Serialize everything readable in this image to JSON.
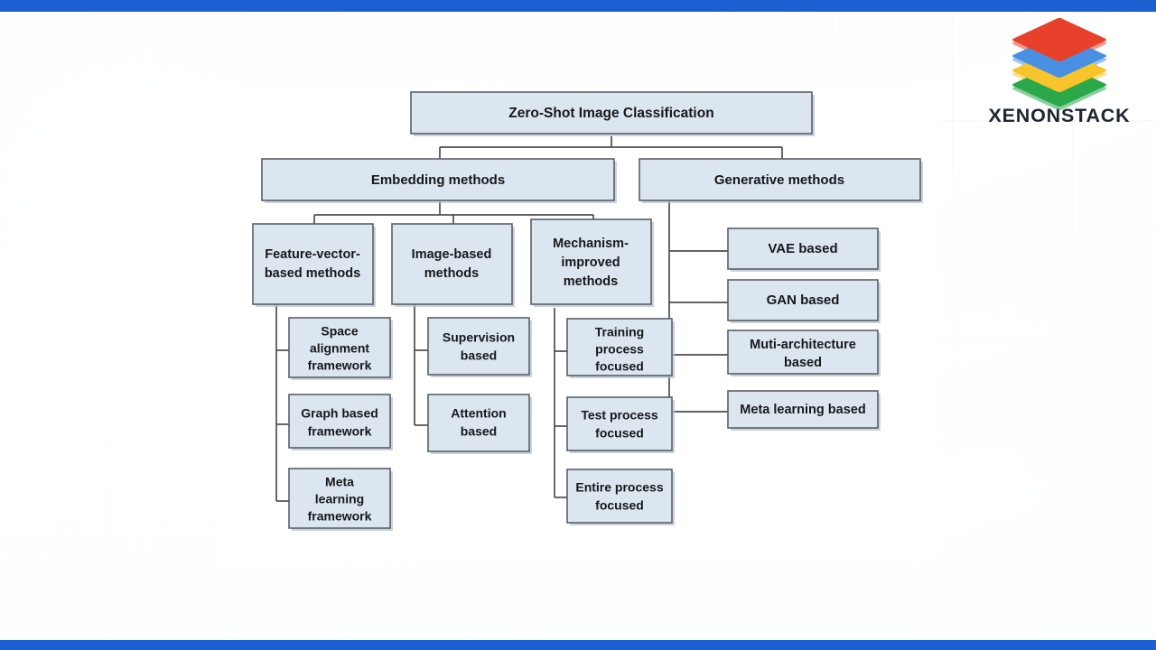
{
  "brand": {
    "name": "XENONSTACK",
    "logo_icon": "stacked-layers-logo",
    "accent_color": "#1b5fd1",
    "wordmark_color": "#1e2533",
    "layer_colors": [
      "#e8412b",
      "#4a90e2",
      "#f7c52b",
      "#2aa84a"
    ]
  },
  "diagram": {
    "type": "hierarchy-tree",
    "node_fill": "#dce6f1",
    "node_stroke": "#5a5f66",
    "link_color": "#4d4d4d",
    "nodes": {
      "root": "Zero-Shot Image Classification",
      "embedding": "Embedding methods",
      "generative": "Generative methods",
      "feature_vector": "Feature-vector-based methods",
      "image_based": "Image-based methods",
      "mechanism": "Mechanism-improved methods",
      "space_alignment": "Space alignment framework",
      "graph_based": "Graph based framework",
      "meta_learning_fw": "Meta learning framework",
      "supervision": "Supervision based",
      "attention": "Attention based",
      "training_process": "Training process focused",
      "test_process": "Test process focused",
      "entire_process": "Entire process focused",
      "vae": "VAE based",
      "gan": "GAN based",
      "multi_arch": "Muti-architecture based",
      "meta_learning_based": "Meta learning based"
    },
    "node_lines": {
      "root": [
        "Zero-Shot Image Classification"
      ],
      "embedding": [
        "Embedding methods"
      ],
      "generative": [
        "Generative methods"
      ],
      "feature_vector": [
        "Feature-vector-",
        "based methods"
      ],
      "image_based": [
        "Image-based",
        "methods"
      ],
      "mechanism": [
        "Mechanism-",
        "improved",
        "methods"
      ],
      "space_alignment": [
        "Space",
        "alignment",
        "framework"
      ],
      "graph_based": [
        "Graph based",
        "framework"
      ],
      "meta_learning_fw": [
        "Meta",
        "learning",
        "framework"
      ],
      "supervision": [
        "Supervision",
        "based"
      ],
      "attention": [
        "Attention",
        "based"
      ],
      "training_process": [
        "Training",
        "process",
        "focused"
      ],
      "test_process": [
        "Test process",
        "focused"
      ],
      "entire_process": [
        "Entire process",
        "focused"
      ],
      "vae": [
        "VAE based"
      ],
      "gan": [
        "GAN based"
      ],
      "multi_arch": [
        "Muti-architecture",
        "based"
      ],
      "meta_learning_based": [
        "Meta learning based"
      ]
    }
  }
}
